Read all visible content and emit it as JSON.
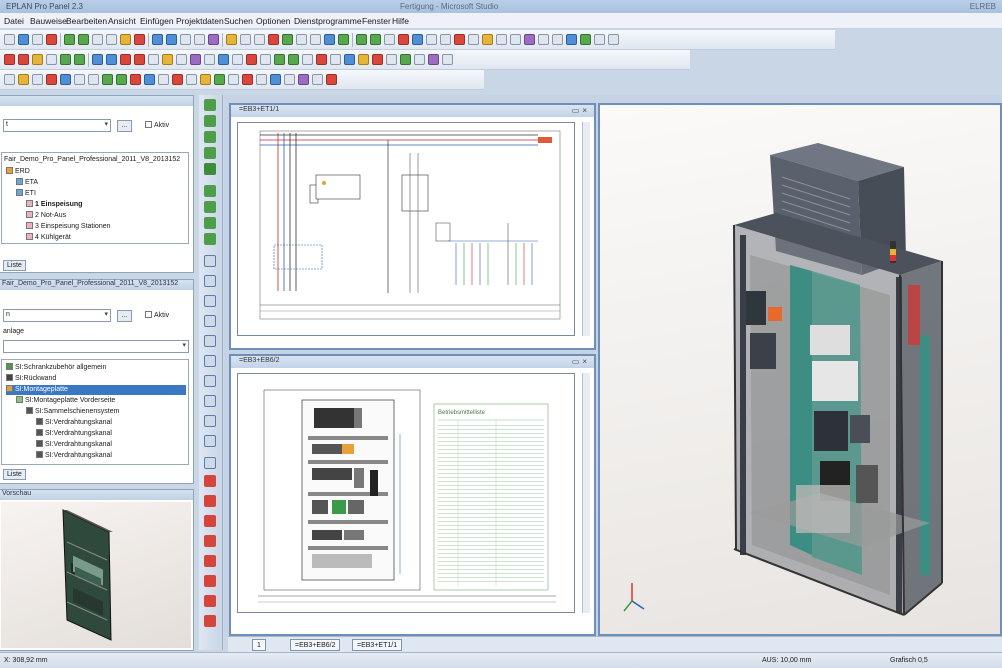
{
  "window": {
    "app_title": "EPLAN Pro Panel 2.3",
    "doc_title": "Fertigung - Microsoft Studio",
    "right_text": "ELREB"
  },
  "menu": [
    "Datei",
    "Bauweise",
    "Bearbeiten",
    "Ansicht",
    "Einfügen",
    "Projektdaten",
    "Suchen",
    "Optionen",
    "Dienstprogramme",
    "Fenster",
    "Hilfe"
  ],
  "panel1": {
    "filter_value": "t",
    "btn": "...",
    "active_label": "Aktiv",
    "root": "Fair_Demo_Pro_Panel_Professional_2011_V8_2013152",
    "items": [
      {
        "label": "ERD",
        "indent": 0,
        "color": "#e7a23a",
        "selected": false,
        "bold": false
      },
      {
        "label": "ETA",
        "indent": 1,
        "color": "#67a8d8",
        "selected": false,
        "bold": false
      },
      {
        "label": "ETI",
        "indent": 1,
        "color": "#67a8d8",
        "selected": false,
        "bold": false
      },
      {
        "label": "1 Einspeisung",
        "indent": 2,
        "color": "#e8b3bf",
        "selected": false,
        "bold": true
      },
      {
        "label": "2 Not-Aus",
        "indent": 2,
        "color": "#e8b3bf",
        "selected": false,
        "bold": false
      },
      {
        "label": "3 Einspeisung Stationen",
        "indent": 2,
        "color": "#e8b3bf",
        "selected": false,
        "bold": false
      },
      {
        "label": "4 Kühlgerät",
        "indent": 2,
        "color": "#e8b3bf",
        "selected": false,
        "bold": false
      }
    ],
    "tab": "Liste"
  },
  "panel2": {
    "root": "Fair_Demo_Pro_Panel_Professional_2011_V8_2013152",
    "filter_value": "n",
    "btn": "...",
    "active_label": "Aktiv",
    "field_label": "anlage",
    "items": [
      {
        "label": "SI:Schrankzubehör allgemein",
        "indent": 0,
        "color": "#4e9a4a",
        "selected": false
      },
      {
        "label": "SI:Rückwand",
        "indent": 0,
        "color": "#444",
        "selected": false
      },
      {
        "label": "SI:Montageplatte",
        "indent": 0,
        "color": "#d8a24a",
        "selected": true
      },
      {
        "label": "SI:Montageplatte Vorderseite",
        "indent": 1,
        "color": "#8ac47e",
        "selected": false
      },
      {
        "label": "SI:Sammelschienensystem",
        "indent": 2,
        "color": "#555",
        "selected": false
      },
      {
        "label": "SI:Verdrahtungskanal",
        "indent": 3,
        "color": "#555",
        "selected": false
      },
      {
        "label": "SI:Verdrahtungskanal",
        "indent": 3,
        "color": "#555",
        "selected": false
      },
      {
        "label": "SI:Verdrahtungskanal",
        "indent": 3,
        "color": "#555",
        "selected": false
      },
      {
        "label": "SI:Verdrahtungskanal",
        "indent": 3,
        "color": "#555",
        "selected": false
      }
    ],
    "tab": "Liste"
  },
  "preview": {
    "title": "Vorschau"
  },
  "windows": {
    "schematic_title": "=EB3+ET1/1",
    "layout_title": "=EB3+EB6/2",
    "legend_title": "Betriebsmittelliste"
  },
  "bottom_tabs": [
    "=EB3+EB6/2",
    "=EB3+ET1/1"
  ],
  "page_number": "1",
  "status": {
    "left": "X: 308,92 mm",
    "mid": "AUS: 10,00 mm",
    "right": "Grafisch 0,5"
  }
}
